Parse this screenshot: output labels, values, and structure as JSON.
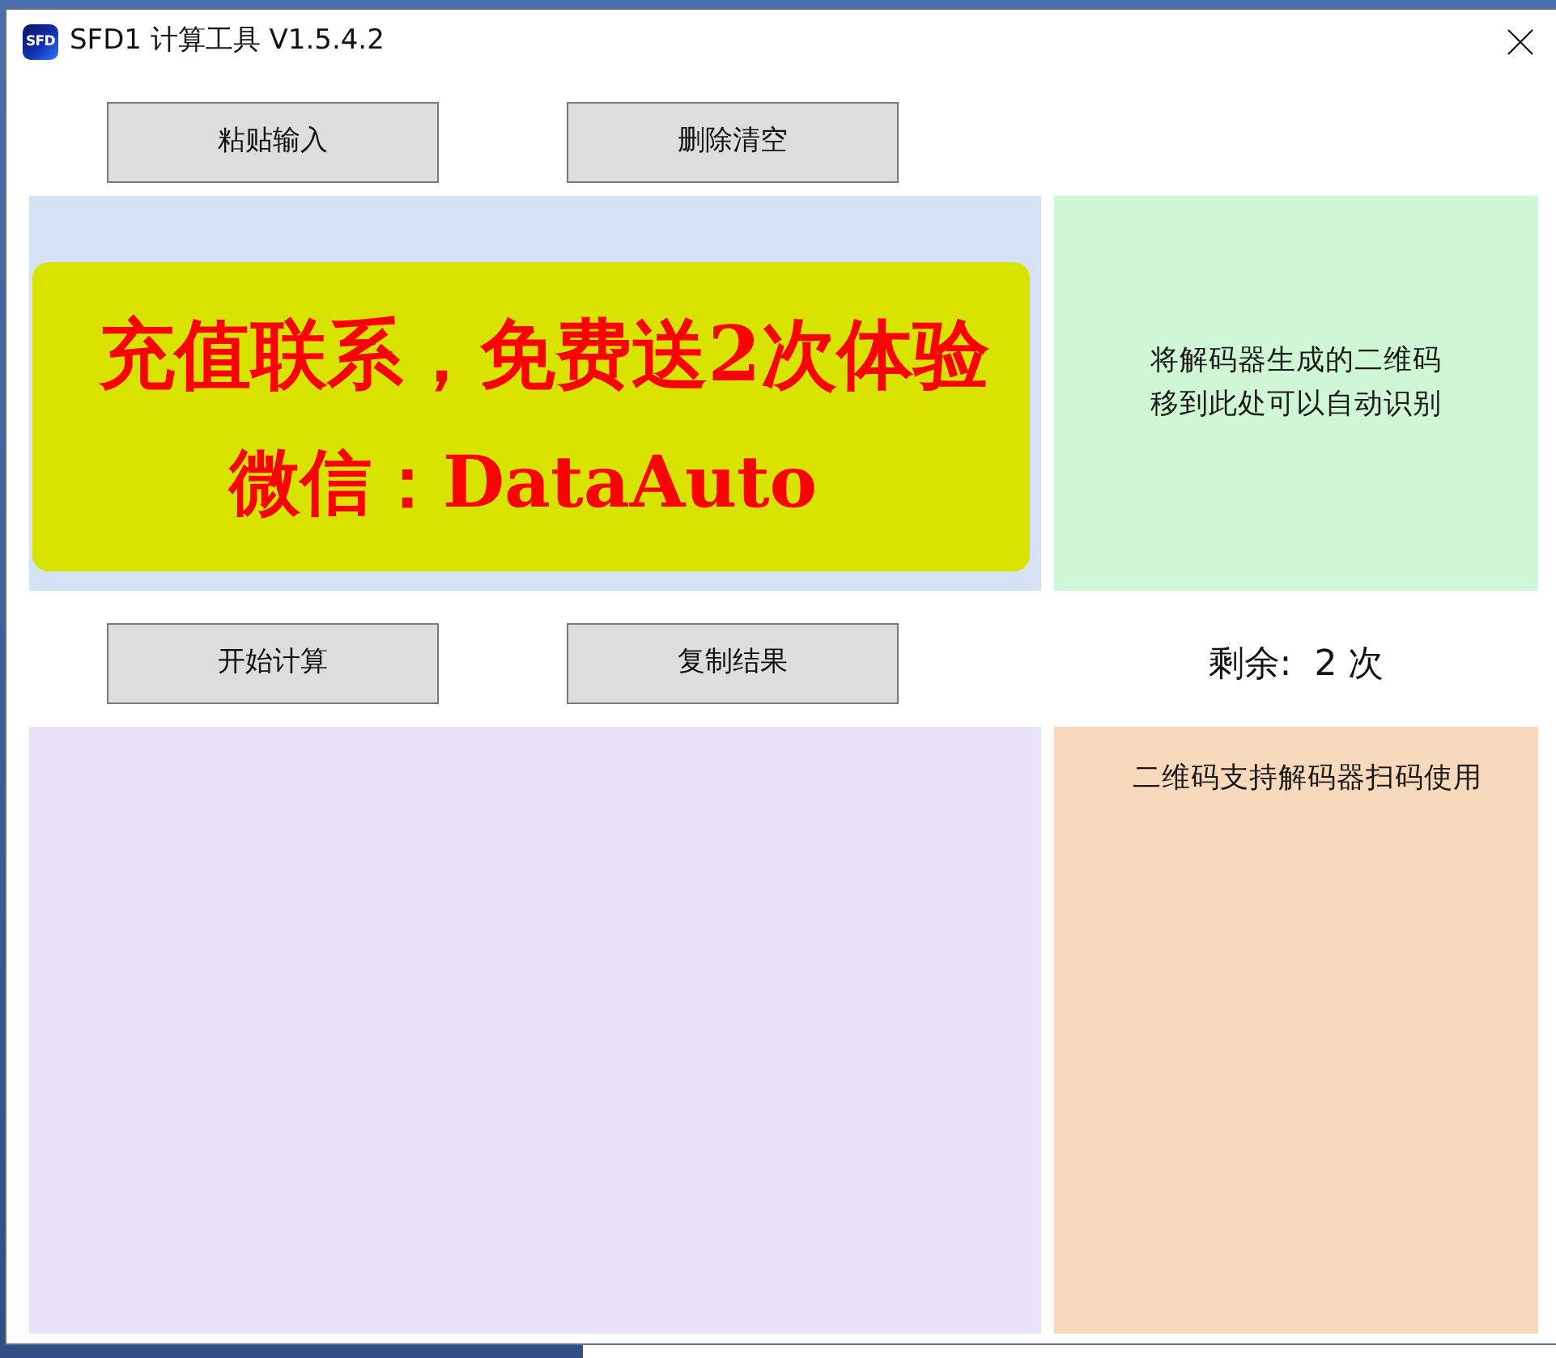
{
  "window": {
    "icon_text": "SFD",
    "title": "SFD1 计算工具 V1.5.4.2"
  },
  "input_buttons": [
    "粘贴输入",
    "删除清空"
  ],
  "promo_banner": {
    "lines": [
      "充值联系，免费送2次体验",
      "微信：DataAuto"
    ]
  },
  "qr_drop_area": {
    "lines": [
      "将解码器生成的二维码",
      "移到此处可以自动识别"
    ]
  },
  "action_buttons": [
    "开始计算",
    "复制结果"
  ],
  "remaining": "剩余:  2 次",
  "qr_panel": {
    "caption": "二维码支持解码器扫码使用"
  }
}
